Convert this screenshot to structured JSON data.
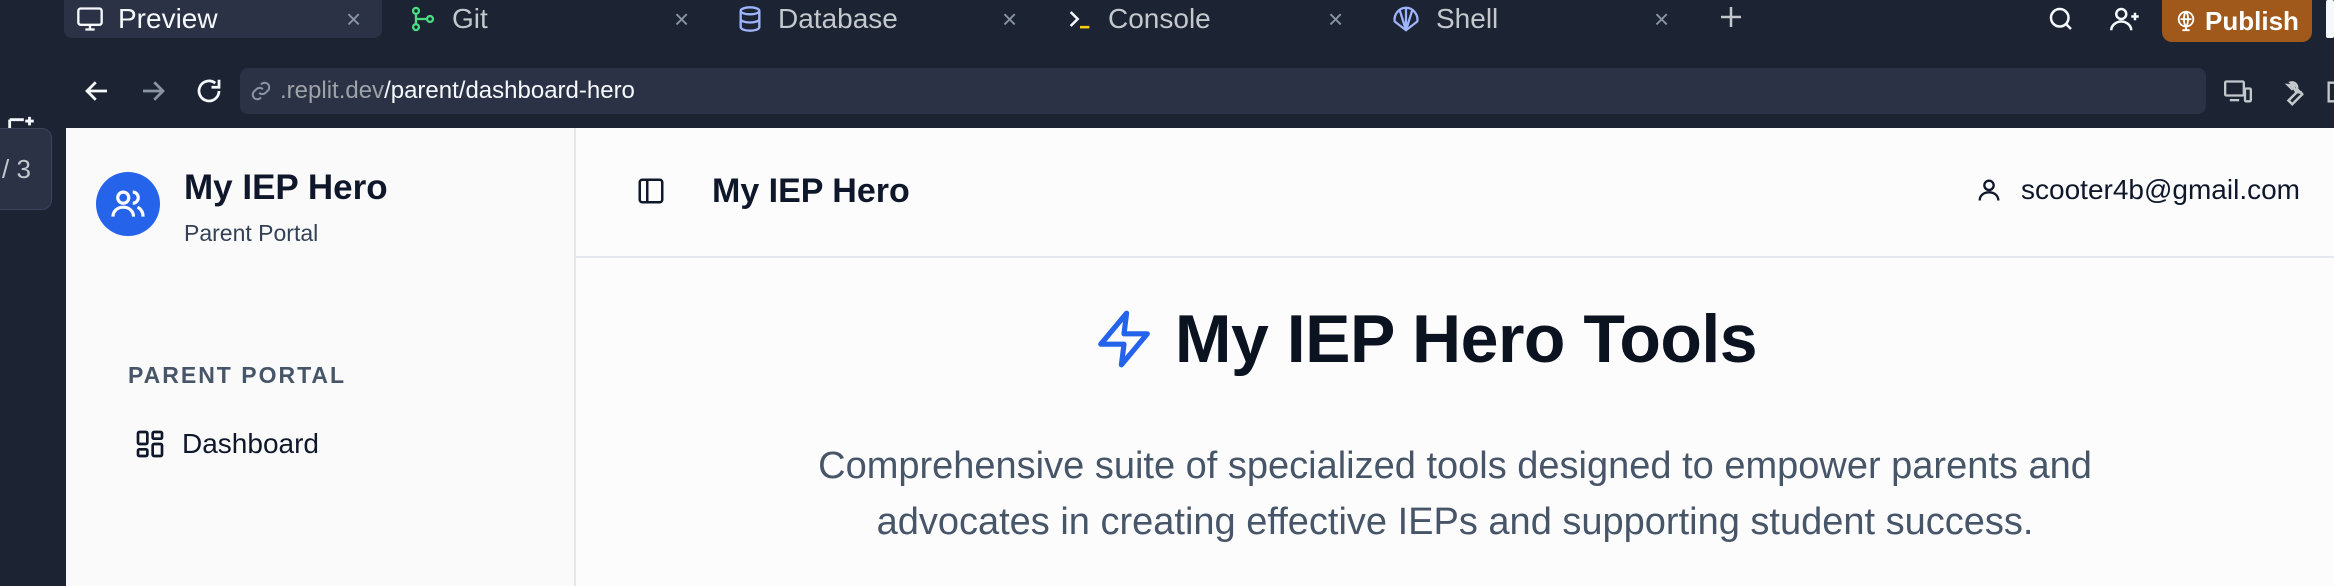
{
  "tabs": [
    {
      "label": "Preview",
      "icon": "monitor-icon",
      "active": true
    },
    {
      "label": "Git",
      "icon": "git-branch-icon",
      "active": false
    },
    {
      "label": "Database",
      "icon": "database-icon",
      "active": false
    },
    {
      "label": "Console",
      "icon": "terminal-icon",
      "active": false
    },
    {
      "label": "Shell",
      "icon": "shell-icon",
      "active": false
    }
  ],
  "tab_close_glyph": "×",
  "top_actions": {
    "publish_label": "Publish"
  },
  "left_rail": {
    "pager": "/ 3"
  },
  "address_bar": {
    "domain": ".replit.dev",
    "path": "/parent/dashboard-hero"
  },
  "sidebar": {
    "brand_title": "My IEP Hero",
    "brand_subtitle": "Parent Portal",
    "section_label": "PARENT PORTAL",
    "items": [
      {
        "label": "Dashboard",
        "icon": "dashboard-grid-icon"
      }
    ]
  },
  "header": {
    "title": "My IEP Hero",
    "user_email": "scooter4b@gmail.com"
  },
  "hero": {
    "title": "My IEP Hero Tools",
    "description": "Comprehensive suite of specialized tools designed to empower parents and advocates in creating effective IEPs and supporting student success."
  },
  "colors": {
    "ide_background": "#1c2333",
    "accent_blue": "#2563eb",
    "publish_orange": "#a0591a"
  }
}
